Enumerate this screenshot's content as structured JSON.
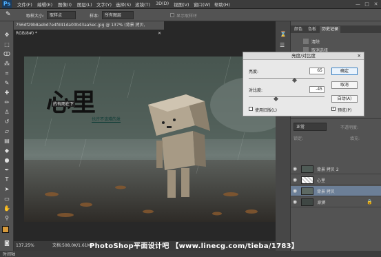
{
  "app": {
    "logo": "Ps"
  },
  "menubar": {
    "items": [
      "文件(F)",
      "编辑(E)",
      "图像(I)",
      "图层(L)",
      "文字(Y)",
      "选择(S)",
      "滤镜(T)",
      "3D(D)",
      "视图(V)",
      "窗口(W)",
      "帮助(H)"
    ],
    "window_controls": [
      "—",
      "□",
      "✕"
    ]
  },
  "options": {
    "sample_size_label": "取样大小:",
    "sample_size_value": "取样点",
    "sample_label": "样本:",
    "sample_value": "所有图层",
    "ring_label": "显示取样环"
  },
  "document": {
    "tab_title": "756df29b8aebd7e4fd41da00b43aa5ec.jpg @ 137% (背景 拷贝, RGB/8#) *",
    "headline": "心里",
    "sub1": "的有雨在下",
    "sub2": "也许不该难的发"
  },
  "status": {
    "zoom": "137.25%",
    "doc": "文档:508.0K/1.61M"
  },
  "bottom_tab": "时间轴",
  "history_panel": {
    "tabs": [
      "颜色",
      "色板",
      "历史记录"
    ],
    "items": [
      "清除",
      "取消选择"
    ]
  },
  "dialog": {
    "title": "亮度/对比度",
    "brightness_label": "亮度:",
    "brightness_value": "65",
    "contrast_label": "对比度:",
    "contrast_value": "-45",
    "brightness_level": 0.6,
    "contrast_level": 0.35,
    "ok": "确定",
    "cancel": "取消",
    "auto": "自动(A)",
    "legacy": "使用旧版(L)",
    "preview": "预览(P)"
  },
  "layers_panel": {
    "mode": "正常",
    "opacity_label": "不透明度:",
    "lock_label": "锁定:",
    "fill_label": "填充:",
    "layers": [
      {
        "name": "背景 拷贝 2",
        "selected": false
      },
      {
        "name": "心里",
        "selected": false
      },
      {
        "name": "背景 拷贝",
        "selected": true
      },
      {
        "name": "背景",
        "selected": false
      }
    ]
  },
  "watermark": "PhotoShop平面设计吧 【www.linecg.com/tieba/1783】",
  "colors": {
    "accent": "#6c7f97",
    "fg_swatch": "#d79a3b",
    "bg_swatch": "#ffffff"
  }
}
